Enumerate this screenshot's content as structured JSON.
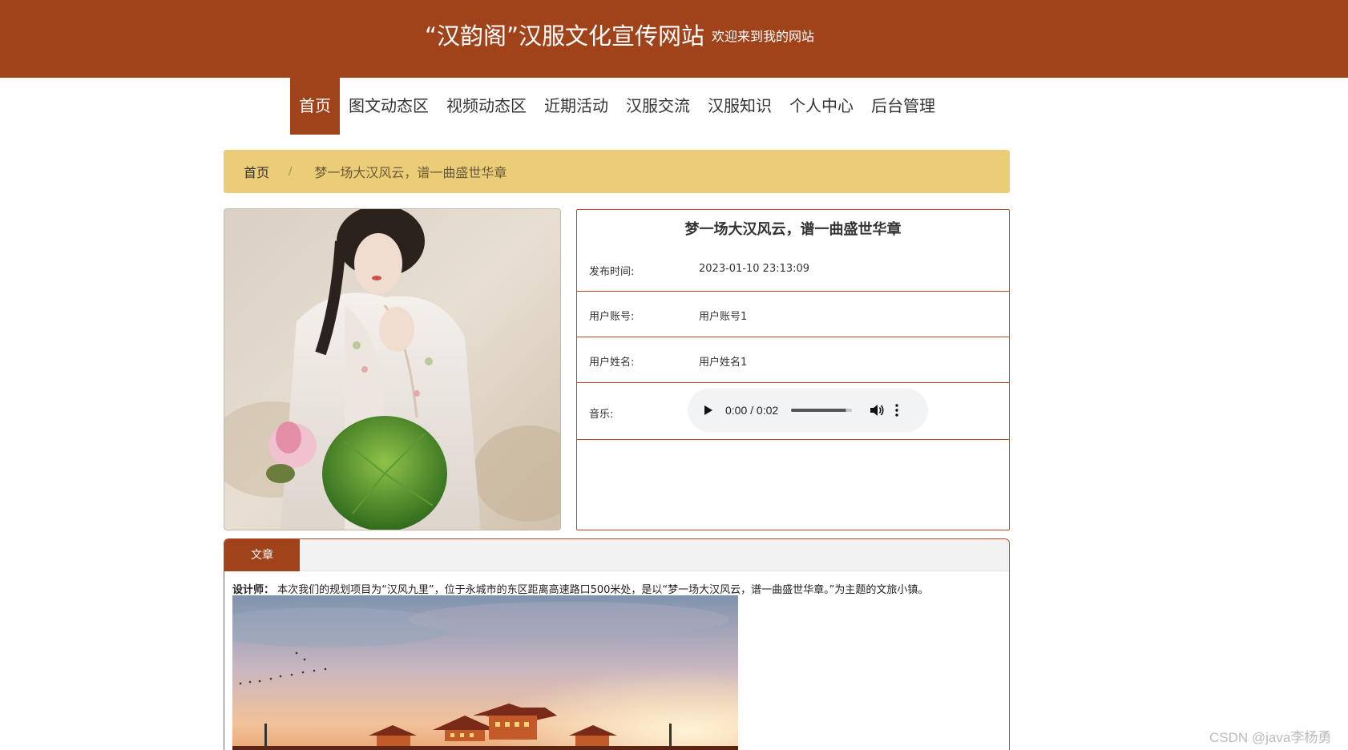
{
  "header": {
    "title": "“汉韵阁”汉服文化宣传网站",
    "subtitle": "欢迎来到我的网站"
  },
  "nav": {
    "items": [
      {
        "label": "首页",
        "active": true
      },
      {
        "label": "图文动态区"
      },
      {
        "label": "视频动态区"
      },
      {
        "label": "近期活动"
      },
      {
        "label": "汉服交流"
      },
      {
        "label": "汉服知识"
      },
      {
        "label": "个人中心"
      },
      {
        "label": "后台管理"
      }
    ]
  },
  "breadcrumb": {
    "home": "首页",
    "separator": "/",
    "current": "梦一场大汉风云，谱一曲盛世华章"
  },
  "detail": {
    "title": "梦一场大汉风云，谱一曲盛世华章",
    "publish_time_label": "发布时间:",
    "publish_time": "2023-01-10 23:13:09",
    "account_label": "用户账号:",
    "account": "用户账号1",
    "name_label": "用户姓名:",
    "name": "用户姓名1",
    "music_label": "音乐:",
    "audio": {
      "time": "0:00 / 0:02",
      "progress": 0,
      "volume": 0.9
    }
  },
  "panel": {
    "tab_label": "文章",
    "article_label": "设计师：",
    "article_text": " 本次我们的规划项目为“汉风九里”，位于永城市的东区距离高速路口500米处，是以“梦一场大汉风云，谱一曲盛世华章。”为主题的文旅小镇。"
  },
  "watermark": "CSDN @java李杨勇",
  "colors": {
    "primary": "#a0431a",
    "breadcrumb_bg": "#ebcd78",
    "border": "#b8461e"
  }
}
